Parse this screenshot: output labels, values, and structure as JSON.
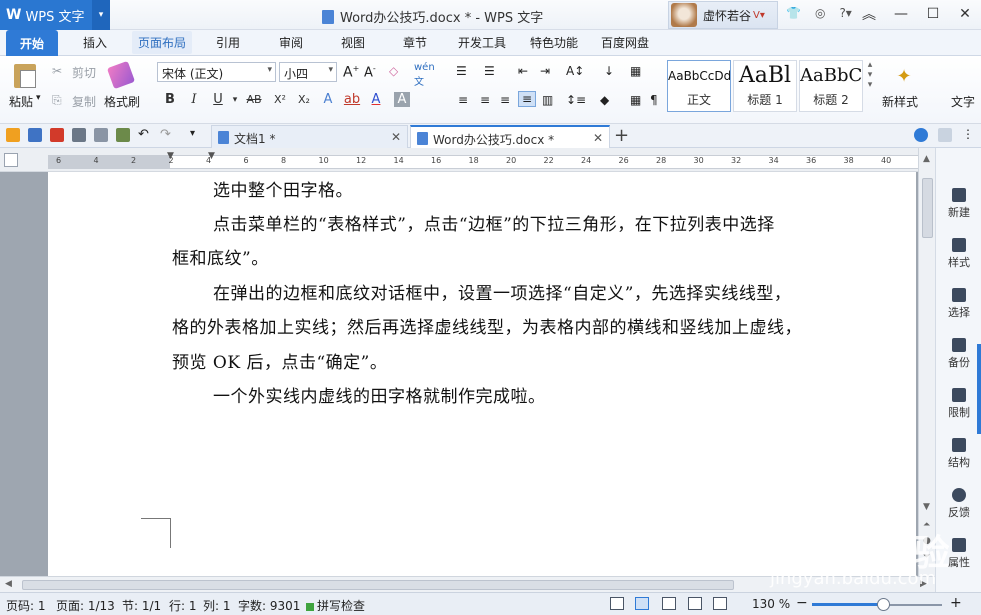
{
  "app": {
    "name": "WPS 文字"
  },
  "window": {
    "title": "Word办公技巧.docx * - WPS 文字"
  },
  "user": {
    "name": "虚怀若谷"
  },
  "menu": {
    "tabs": [
      "开始",
      "插入",
      "页面布局",
      "引用",
      "审阅",
      "视图",
      "章节",
      "开发工具",
      "特色功能",
      "百度网盘"
    ],
    "active": "开始",
    "hover": "页面布局"
  },
  "toolbar": {
    "paste": "粘贴",
    "cut": "剪切",
    "copy": "复制",
    "format_painter": "格式刷",
    "font_name": "宋体 (正文)",
    "font_size": "小四",
    "bold": "B",
    "italic": "I",
    "underline": "U",
    "strike": "AB",
    "superscript": "X²",
    "subscript": "X₂",
    "styles": [
      {
        "sample": "AaBbCcDd",
        "name": "正文"
      },
      {
        "sample": "AaBl",
        "name": "标题 1"
      },
      {
        "sample": "AaBbC",
        "name": "标题 2"
      }
    ],
    "new_style": "新样式",
    "more": "文字"
  },
  "tabs_bar": {
    "docs": [
      {
        "name": "文档1 *",
        "active": false
      },
      {
        "name": "Word办公技巧.docx *",
        "active": true
      }
    ]
  },
  "ruler": {
    "labels": [
      "6",
      "4",
      "2",
      "2",
      "4",
      "6",
      "8",
      "10",
      "12",
      "14",
      "16",
      "18",
      "20",
      "22",
      "24",
      "26",
      "28",
      "30",
      "32",
      "34",
      "36",
      "38",
      "40"
    ]
  },
  "document": {
    "lines": [
      "选中整个田字格。",
      "点击菜单栏的“表格样式”，点击“边框”的下拉三角形，在下拉列表中选择",
      "框和底纹”。",
      "在弹出的边框和底纹对话框中，设置一项选择“自定义”，先选择实线线型，",
      "格的外表格加上实线；然后再选择虚线线型，为表格内部的横线和竖线加上虚线，",
      "预览 OK 后，点击“确定”。",
      "一个外实线内虚线的田字格就制作完成啦。"
    ]
  },
  "sidebar": {
    "items": [
      "新建",
      "样式",
      "选择",
      "备份",
      "限制",
      "结构",
      "反馈",
      "属性"
    ]
  },
  "status": {
    "page": "页码: 1",
    "pages": "页面: 1/13",
    "section": "节: 1/1",
    "row": "行: 1",
    "col": "列: 1",
    "words": "字数: 9301",
    "spell": "拼写检查",
    "zoom": "130 %",
    "zoom_percent": 130
  },
  "watermark": {
    "logo": "Baidu经验",
    "url": "jingyan.baidu.com"
  },
  "colors": {
    "accent": "#2f7ad6",
    "app_blue": "#2a77d1"
  }
}
